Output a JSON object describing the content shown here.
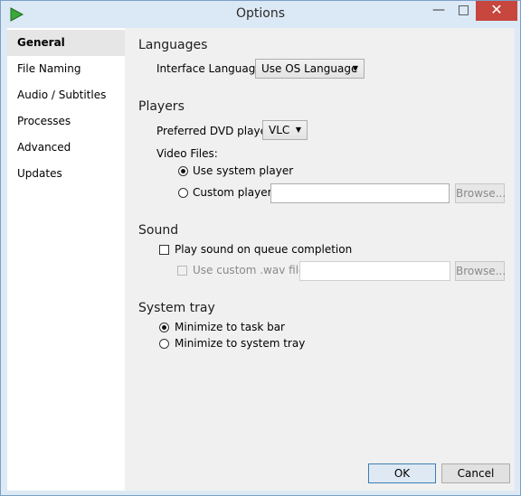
{
  "window": {
    "title": "Options",
    "minimize_glyph": "—",
    "maximize_glyph": "□",
    "close_glyph": "✕",
    "accent": "#c7463d"
  },
  "sidebar": {
    "items": [
      {
        "label": "General",
        "selected": true
      },
      {
        "label": "File Naming"
      },
      {
        "label": "Audio / Subtitles"
      },
      {
        "label": "Processes"
      },
      {
        "label": "Advanced"
      },
      {
        "label": "Updates"
      }
    ]
  },
  "languages": {
    "heading": "Languages",
    "interface_label": "Interface Language:",
    "interface_value": "Use OS Language"
  },
  "players": {
    "heading": "Players",
    "dvd_label": "Preferred DVD player:",
    "dvd_value": "VLC",
    "video_files_label": "Video Files:",
    "system_player_label": "Use system player",
    "custom_player_label": "Custom player:",
    "custom_player_value": "",
    "browse_label": "Browse...",
    "selected": "system"
  },
  "sound": {
    "heading": "Sound",
    "play_sound_label": "Play sound on queue completion",
    "play_sound_checked": false,
    "custom_wav_label": "Use custom .wav file:",
    "custom_wav_value": "",
    "browse_label": "Browse..."
  },
  "system_tray": {
    "heading": "System tray",
    "task_bar_label": "Minimize to task bar",
    "system_tray_label": "Minimize to system tray",
    "selected": "task_bar"
  },
  "footer": {
    "ok_label": "OK",
    "cancel_label": "Cancel"
  },
  "icons": {
    "app": "app-play-icon",
    "dropdown": "chevron-down-icon"
  }
}
